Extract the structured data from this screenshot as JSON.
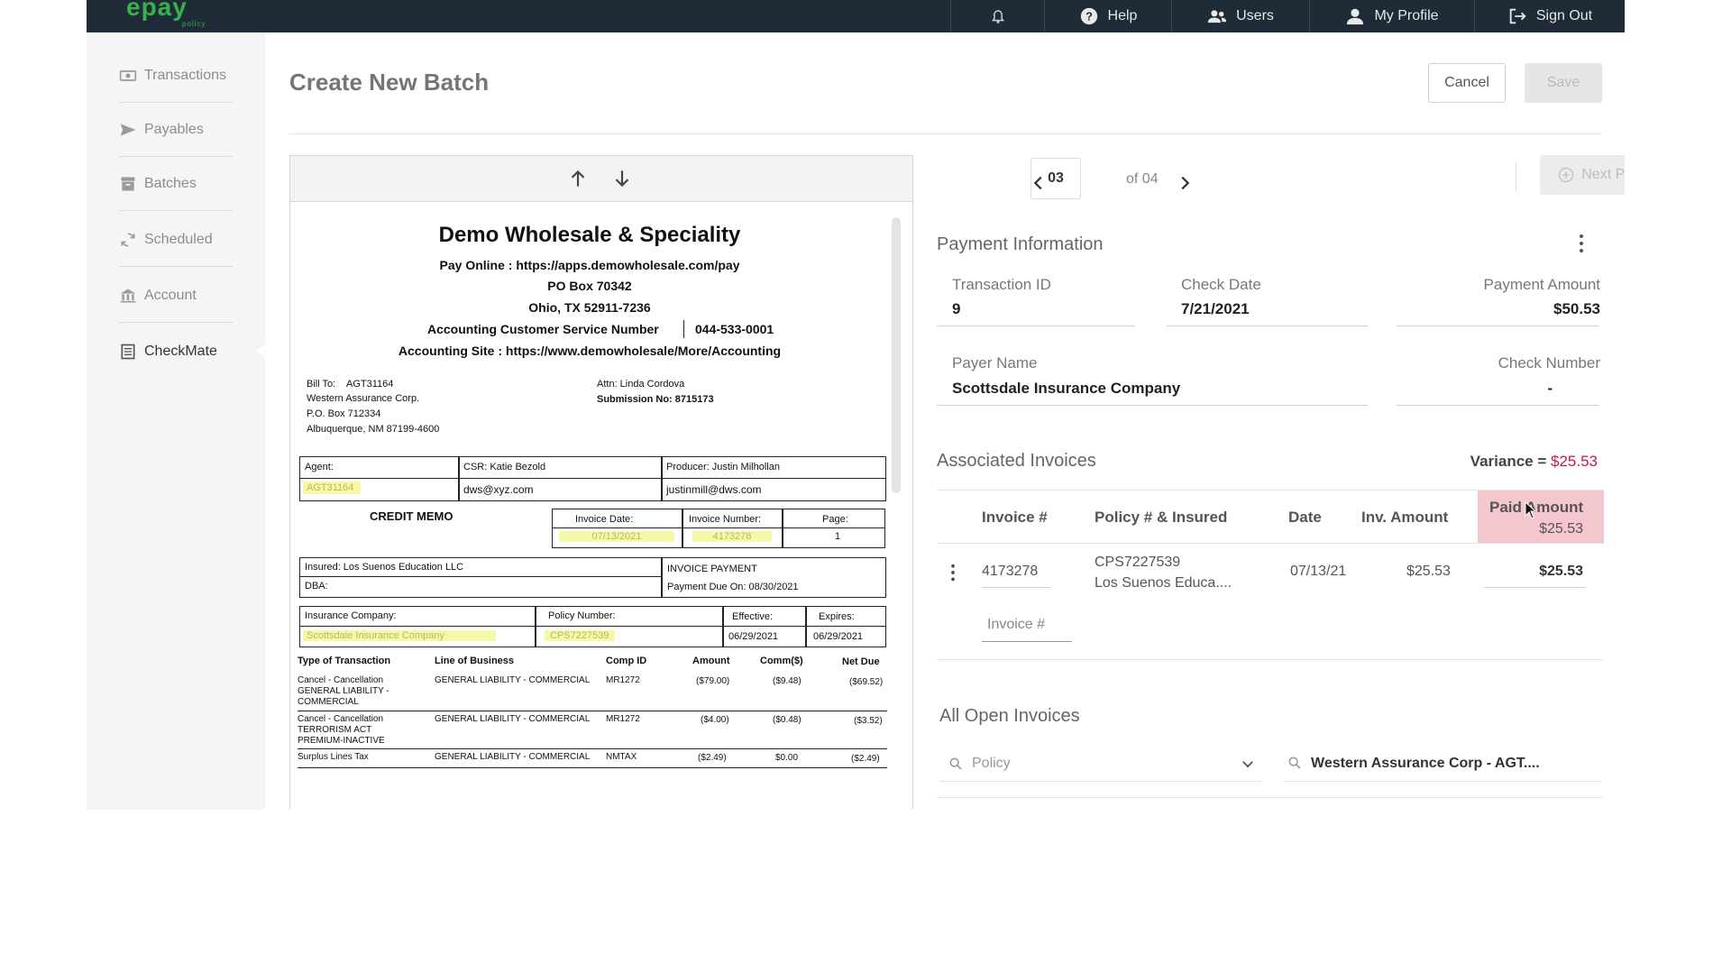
{
  "topbar": {
    "logo": "epay",
    "logo_sub": "policy",
    "nav": [
      {
        "label": "",
        "icon": "bell-icon"
      },
      {
        "label": "Help",
        "icon": "help-icon"
      },
      {
        "label": "Users",
        "icon": "users-icon"
      },
      {
        "label": "My Profile",
        "icon": "profile-icon"
      },
      {
        "label": "Sign Out",
        "icon": "sign-out-icon"
      }
    ]
  },
  "sidebar": {
    "items": [
      {
        "label": "Transactions",
        "icon": "transactions-icon"
      },
      {
        "label": "Payables",
        "icon": "payables-icon"
      },
      {
        "label": "Batches",
        "icon": "batches-icon"
      },
      {
        "label": "Scheduled",
        "icon": "scheduled-icon"
      },
      {
        "label": "Account",
        "icon": "account-icon"
      },
      {
        "label": "CheckMate",
        "icon": "checkmate-icon",
        "active": true
      }
    ]
  },
  "page": {
    "title": "Create New Batch",
    "cancel_label": "Cancel",
    "save_label": "Save"
  },
  "document": {
    "company": "Demo Wholesale & Speciality",
    "pay_online": "Pay Online : https://apps.demowholesale.com/pay",
    "po_box": "PO Box 70342",
    "city": "Ohio, TX 52911-7236",
    "service_number_label": "Accounting Customer Service Number",
    "service_number": "044-533-0001",
    "accounting_site": "Accounting Site : https://www.demowholesale/More/Accounting",
    "bill_to_label": "Bill To:",
    "bill_to_id": "AGT31164",
    "bill_to_name": "Western Assurance Corp.",
    "bill_to_po": "P.O. Box 712334",
    "bill_to_city": "Albuquerque, NM  87199-4600",
    "attn": "Attn: Linda Cordova",
    "submission": "Submission No: 8715173",
    "agent_label": "Agent:",
    "agent_value": "AGT31164",
    "csr": "CSR:  Katie Bezold",
    "csr_email": "dws@xyz.com",
    "producer": "Producer: Justin Milhollan",
    "producer_email": "justinmill@dws.com",
    "memo_title": "CREDIT MEMO",
    "invoice_date_label": "Invoice Date:",
    "invoice_date": "07/13/2021",
    "invoice_number_label": "Invoice Number:",
    "invoice_number": "4173278",
    "page_label": "Page:",
    "page_value": "1",
    "insured": "Insured:   Los Suenos Education LLC",
    "dba": "DBA:",
    "invoice_payment": "INVOICE PAYMENT",
    "payment_due": "Payment Due On:   08/30/2021",
    "ins_company_label": "Insurance Company:",
    "ins_company": "Scottsdale Insurance Company",
    "policy_label": "Policy Number:",
    "policy": "CPS7227539",
    "effective_label": "Effective:",
    "effective": "06/29/2021",
    "expires_label": "Expires:",
    "expires": "06/29/2021",
    "table_headers": [
      "Type of Transaction",
      "Line of Business",
      "Comp ID",
      "Amount",
      "Comm($)",
      "Net Due"
    ],
    "rows": [
      {
        "type": [
          "Cancel - Cancellation",
          "GENERAL LIABILITY -",
          "COMMERCIAL"
        ],
        "lob": "GENERAL LIABILITY - COMMERCIAL",
        "comp": "MR1272",
        "amount": "($79.00)",
        "comm": "($9.48)",
        "net": "($69.52)"
      },
      {
        "type": [
          "Cancel - Cancellation",
          "TERRORISM ACT",
          "PREMIUM-INACTIVE"
        ],
        "lob": "GENERAL LIABILITY - COMMERCIAL",
        "comp": "MR1272",
        "amount": "($4.00)",
        "comm": "($0.48)",
        "net": "($3.52)"
      },
      {
        "type": [
          "Surplus Lines Tax"
        ],
        "lob": "GENERAL LIABILITY - COMMERCIAL",
        "comp": "NMTAX",
        "amount": "($2.49)",
        "comm": "$0.00",
        "net": "($2.49)"
      }
    ]
  },
  "pager": {
    "current": "03",
    "of": "of 04",
    "next_payment_label": "Next Payment"
  },
  "payment_info": {
    "title": "Payment Information",
    "transaction_id_label": "Transaction ID",
    "transaction_id": "9",
    "check_date_label": "Check Date",
    "check_date": "7/21/2021",
    "payment_amount_label": "Payment Amount",
    "payment_amount": "$50.53",
    "payer_name_label": "Payer Name",
    "payer_name": "Scottsdale Insurance Company",
    "check_number_label": "Check Number",
    "check_number": "-"
  },
  "associated": {
    "title": "Associated Invoices",
    "variance_label": "Variance =",
    "variance": "$25.53",
    "variance_color": "#c2185b",
    "columns": [
      "Invoice #",
      "Policy # & Insured",
      "Date",
      "Inv. Amount",
      "Paid Amount"
    ],
    "paid_total": "$25.53",
    "row": {
      "invoice": "4173278",
      "policy": "CPS7227539",
      "insured": "Los Suenos Educa....",
      "date": "07/13/21",
      "inv_amount": "$25.53",
      "paid_amount": "$25.53"
    },
    "new_invoice_placeholder": "Invoice #"
  },
  "open_invoices": {
    "title": "All Open Invoices",
    "policy_placeholder": "Policy",
    "agency_value": "Western Assurance Corp - AGT...."
  }
}
